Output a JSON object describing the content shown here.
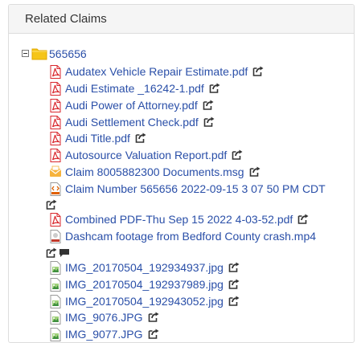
{
  "panel": {
    "title": "Related Claims"
  },
  "tree": {
    "root_label": "565656",
    "items": [
      {
        "label": "Audatex Vehicle Repair Estimate.pdf",
        "type": "pdf"
      },
      {
        "label": "Audi Estimate _16242-1.pdf",
        "type": "pdf"
      },
      {
        "label": "Audi Power of Attorney.pdf",
        "type": "pdf"
      },
      {
        "label": "Audi Settlement Check.pdf",
        "type": "pdf"
      },
      {
        "label": "Audi Title.pdf",
        "type": "pdf"
      },
      {
        "label": "Autosource Valuation Report.pdf",
        "type": "pdf"
      },
      {
        "label": "Claim 8005882300 Documents.msg",
        "type": "msg"
      },
      {
        "label": "Claim Number 565656 2022-09-15 3 07 50 PM CDT",
        "type": "html"
      },
      {
        "label": "Combined PDF-Thu Sep 15 2022 4-03-52.pdf",
        "type": "pdf"
      },
      {
        "label": "Dashcam footage from Bedford County crash.mp4",
        "type": "mp4"
      },
      {
        "label": "IMG_20170504_192934937.jpg",
        "type": "jpg"
      },
      {
        "label": "IMG_20170504_192937989.jpg",
        "type": "jpg"
      },
      {
        "label": "IMG_20170504_192943052.jpg",
        "type": "jpg"
      },
      {
        "label": "IMG_9076.JPG",
        "type": "jpg"
      },
      {
        "label": "IMG_9077.JPG",
        "type": "jpg"
      }
    ]
  },
  "colors": {
    "link": "#2a4fa8",
    "pdf_red": "#d9262c",
    "folder_yellow": "#f5c518",
    "panel_heading_bg": "#f5f5f5",
    "border": "#dddddd"
  },
  "icons": {
    "folder": "folder-icon",
    "pdf": "pdf-file-icon",
    "msg": "email-file-icon",
    "html": "html-file-icon",
    "mp4": "video-file-icon",
    "jpg": "image-file-icon",
    "share": "share-icon",
    "comment": "comment-icon"
  }
}
